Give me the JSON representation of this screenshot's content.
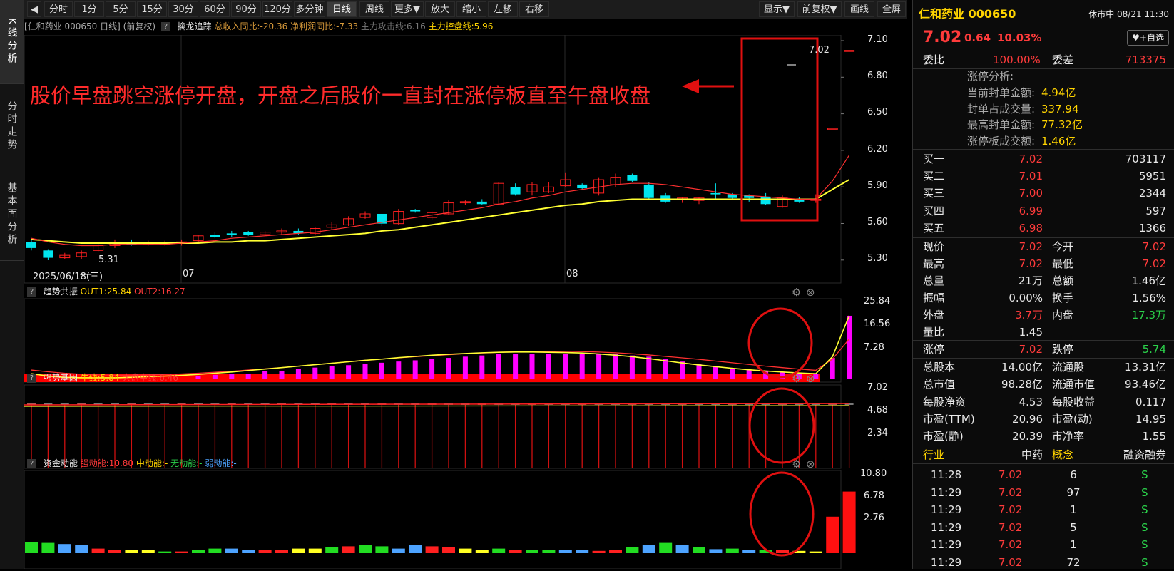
{
  "left_tabs": [
    "K线分析",
    "分时走势",
    "基本面分析"
  ],
  "toolbar": {
    "back_label": "◀",
    "periods": [
      "分时",
      "1分",
      "5分",
      "15分",
      "30分",
      "60分",
      "90分",
      "120分",
      "多分钟",
      "日线",
      "周线",
      "更多▼"
    ],
    "active_period": "日线",
    "actions": [
      "放大",
      "缩小",
      "左移",
      "右移"
    ],
    "right": [
      "显示▼",
      "前复权▼",
      "画线",
      "全屏"
    ]
  },
  "main_info": {
    "name": "[仁和药业 000650 日线]",
    "adjust": "(前复权)",
    "indicator": "擒龙追踪",
    "revenue": "总收入同比:-20.36",
    "profit": "净利润同比:-7.33",
    "attack": "主力攻击线:6.16",
    "control": "主力控盘线:5.96"
  },
  "annotation": "股价早盘跳空涨停开盘，开盘之后股价一直封在涨停板直至午盘收盘",
  "price_axis": [
    "7.10",
    "6.80",
    "6.50",
    "6.20",
    "5.90",
    "5.60",
    "5.30"
  ],
  "last_price_tag": "7.02",
  "low_price_tag": "5.31",
  "date_axis": {
    "start": "2025/06/18(三)",
    "m1": "07",
    "m2": "08"
  },
  "sub1": {
    "title": "趋势共振",
    "out1": "OUT1:25.84",
    "out2": "OUT2:16.27",
    "axis": [
      "25.84",
      "16.56",
      "7.28"
    ]
  },
  "sub2": {
    "title": "强势基因",
    "bull": "牛线:5.84",
    "market": "大盘中线:6.46",
    "axis": [
      "7.02",
      "4.68",
      "2.34"
    ]
  },
  "sub3": {
    "title": "资金动能",
    "strong": "强动能:10.80",
    "mid": "中动能:-",
    "none": "无动能:-",
    "weak": "弱动能:-",
    "axis": [
      "10.80",
      "6.78",
      "2.76"
    ]
  },
  "colors": {
    "up": "#ff2020",
    "down": "#00e5ee",
    "ma_yellow": "#ffff33",
    "magenta": "#ff00ff",
    "frame": "#e01010"
  },
  "chart_data": {
    "type": "candlestick",
    "ylim": [
      5.2,
      7.15
    ],
    "ohlc": [
      [
        5.45,
        5.47,
        5.38,
        5.4
      ],
      [
        5.38,
        5.39,
        5.3,
        5.32
      ],
      [
        5.32,
        5.36,
        5.31,
        5.34
      ],
      [
        5.33,
        5.38,
        5.31,
        5.36
      ],
      [
        5.38,
        5.44,
        5.37,
        5.42
      ],
      [
        5.42,
        5.47,
        5.4,
        5.44
      ],
      [
        5.45,
        5.47,
        5.42,
        5.43
      ],
      [
        5.43,
        5.46,
        5.42,
        5.44
      ],
      [
        5.44,
        5.46,
        5.42,
        5.44
      ],
      [
        5.44,
        5.47,
        5.42,
        5.45
      ],
      [
        5.46,
        5.51,
        5.44,
        5.5
      ],
      [
        5.51,
        5.53,
        5.48,
        5.49
      ],
      [
        5.52,
        5.54,
        5.49,
        5.51
      ],
      [
        5.53,
        5.54,
        5.5,
        5.51
      ],
      [
        5.51,
        5.54,
        5.5,
        5.53
      ],
      [
        5.53,
        5.56,
        5.51,
        5.54
      ],
      [
        5.54,
        5.56,
        5.51,
        5.52
      ],
      [
        5.52,
        5.57,
        5.51,
        5.56
      ],
      [
        5.57,
        5.61,
        5.55,
        5.59
      ],
      [
        5.59,
        5.66,
        5.58,
        5.64
      ],
      [
        5.65,
        5.7,
        5.64,
        5.68
      ],
      [
        5.68,
        5.67,
        5.58,
        5.6
      ],
      [
        5.6,
        5.72,
        5.59,
        5.7
      ],
      [
        5.71,
        5.72,
        5.69,
        5.7
      ],
      [
        5.65,
        5.7,
        5.63,
        5.69
      ],
      [
        5.68,
        5.79,
        5.67,
        5.77
      ],
      [
        5.77,
        5.79,
        5.75,
        5.78
      ],
      [
        5.78,
        5.8,
        5.75,
        5.76
      ],
      [
        5.76,
        5.94,
        5.75,
        5.93
      ],
      [
        5.9,
        5.93,
        5.83,
        5.84
      ],
      [
        5.86,
        5.94,
        5.83,
        5.92
      ],
      [
        5.86,
        5.94,
        5.85,
        5.9
      ],
      [
        5.91,
        6.02,
        5.9,
        5.96
      ],
      [
        5.92,
        5.93,
        5.88,
        5.89
      ],
      [
        5.85,
        5.98,
        5.83,
        5.96
      ],
      [
        5.92,
        6.01,
        5.9,
        5.98
      ],
      [
        6.0,
        6.01,
        5.94,
        5.95
      ],
      [
        5.92,
        5.94,
        5.8,
        5.81
      ],
      [
        5.83,
        5.85,
        5.77,
        5.78
      ],
      [
        5.8,
        5.82,
        5.77,
        5.81
      ],
      [
        5.79,
        5.82,
        5.76,
        5.81
      ],
      [
        5.85,
        5.93,
        5.8,
        5.84
      ],
      [
        5.84,
        5.85,
        5.8,
        5.81
      ],
      [
        5.83,
        5.84,
        5.78,
        5.81
      ],
      [
        5.82,
        5.85,
        5.75,
        5.76
      ],
      [
        5.74,
        5.83,
        5.73,
        5.81
      ],
      [
        5.8,
        5.82,
        5.77,
        5.78
      ],
      [
        5.79,
        5.84,
        5.77,
        5.8
      ],
      [
        6.38,
        6.38,
        6.38,
        6.38
      ],
      [
        7.02,
        7.02,
        7.02,
        7.02
      ]
    ],
    "attack_line": [
      5.48,
      5.45,
      5.43,
      5.42,
      5.42,
      5.43,
      5.43,
      5.43,
      5.43,
      5.44,
      5.45,
      5.46,
      5.48,
      5.49,
      5.5,
      5.51,
      5.52,
      5.53,
      5.55,
      5.57,
      5.59,
      5.61,
      5.63,
      5.65,
      5.67,
      5.69,
      5.71,
      5.73,
      5.76,
      5.78,
      5.81,
      5.83,
      5.86,
      5.88,
      5.9,
      5.92,
      5.93,
      5.93,
      5.92,
      5.9,
      5.88,
      5.86,
      5.84,
      5.83,
      5.82,
      5.81,
      5.8,
      5.8,
      5.95,
      6.16
    ],
    "control_line": [
      5.47,
      5.46,
      5.45,
      5.44,
      5.44,
      5.44,
      5.44,
      5.44,
      5.44,
      5.44,
      5.44,
      5.45,
      5.45,
      5.46,
      5.46,
      5.47,
      5.48,
      5.49,
      5.5,
      5.51,
      5.52,
      5.54,
      5.55,
      5.57,
      5.59,
      5.61,
      5.63,
      5.65,
      5.67,
      5.69,
      5.71,
      5.73,
      5.75,
      5.76,
      5.78,
      5.79,
      5.8,
      5.8,
      5.8,
      5.8,
      5.8,
      5.8,
      5.8,
      5.8,
      5.8,
      5.8,
      5.8,
      5.8,
      5.88,
      5.96
    ],
    "sub1_bars": [
      1.5,
      0,
      0,
      0,
      0,
      0,
      0,
      0,
      0,
      0,
      1,
      1.5,
      2,
      2,
      3,
      3,
      4,
      4.5,
      5,
      5.5,
      6,
      6.5,
      7,
      7.5,
      8,
      8.5,
      9,
      9.5,
      10,
      10,
      10,
      10,
      10.2,
      10,
      10,
      10,
      9.5,
      9,
      8,
      7,
      6,
      5,
      4,
      3.5,
      3,
      2.5,
      2,
      2,
      8.5,
      25.84
    ],
    "sub1_lines": {
      "out1": [
        2,
        1,
        0.5,
        0.3,
        0.3,
        0.3,
        0.5,
        0.8,
        1,
        1.3,
        1.7,
        2.2,
        2.7,
        3.3,
        3.9,
        4.5,
        5.1,
        5.7,
        6.3,
        6.9,
        7.5,
        8,
        8.6,
        9.1,
        9.6,
        10,
        10.3,
        10.6,
        10.8,
        10.9,
        10.9,
        10.8,
        10.7,
        10.5,
        10.1,
        9.6,
        9,
        8.2,
        7.3,
        6.4,
        5.6,
        4.9,
        4.2,
        3.6,
        3.1,
        2.7,
        2.3,
        2,
        9,
        25.84
      ],
      "out2": [
        3.5,
        2.8,
        2.2,
        1.8,
        1.5,
        1.4,
        1.4,
        1.5,
        1.7,
        1.9,
        2.2,
        2.6,
        3,
        3.5,
        4,
        4.5,
        5.1,
        5.7,
        6.3,
        6.9,
        7.5,
        8,
        8.5,
        9,
        9.4,
        9.8,
        10.2,
        10.5,
        10.8,
        11,
        11.1,
        11.2,
        11.2,
        11.1,
        10.9,
        10.6,
        10.2,
        9.7,
        9.1,
        8.5,
        7.9,
        7.2,
        6.5,
        5.8,
        5.1,
        4.5,
        3.9,
        3.4,
        8,
        16.27
      ]
    },
    "sub2": {
      "bull": 5.84,
      "market": 6.46
    },
    "sub3_bars": [
      2,
      1.8,
      1.6,
      1.4,
      0.8,
      0.6,
      0.6,
      0.5,
      0.3,
      0.3,
      0.6,
      0.8,
      0.8,
      0.6,
      0.5,
      0.6,
      0.8,
      0.8,
      1,
      1.2,
      1.4,
      1.2,
      0.8,
      1.5,
      1.2,
      1,
      0.8,
      0.6,
      0.8,
      0.6,
      0.6,
      0.5,
      0.6,
      0.5,
      0.4,
      0.5,
      1,
      1.5,
      1.8,
      1.5,
      1,
      0.7,
      0.8,
      0.6,
      0.6,
      0.5,
      0.4,
      0.3,
      6.4,
      10.8
    ]
  },
  "quote": {
    "title": "仁和药业 000650",
    "status": "休市中 08/21 11:30",
    "price": "7.02",
    "change": "0.64",
    "pct": "10.03%",
    "fav": "♥+自选",
    "weibi_label": "委比",
    "weibi": "100.00%",
    "weicha_label": "委差",
    "weicha": "713375",
    "limit": {
      "title": "涨停分析:",
      "rows": [
        {
          "label": "当前封单金额:",
          "value": "4.94亿"
        },
        {
          "label": "封单占成交量:",
          "value": "337.94"
        },
        {
          "label": "最高封单金额:",
          "value": "77.32亿"
        },
        {
          "label": "涨停板成交额:",
          "value": "1.46亿"
        }
      ]
    },
    "bids": [
      {
        "label": "买一",
        "price": "7.02",
        "vol": "703117"
      },
      {
        "label": "买二",
        "price": "7.01",
        "vol": "5951"
      },
      {
        "label": "买三",
        "price": "7.00",
        "vol": "2344"
      },
      {
        "label": "买四",
        "price": "6.99",
        "vol": "597"
      },
      {
        "label": "买五",
        "price": "6.98",
        "vol": "1366"
      }
    ],
    "stats1": [
      {
        "l1": "现价",
        "v1": "7.02",
        "c1": "red",
        "l2": "今开",
        "v2": "7.02",
        "c2": "red"
      },
      {
        "l1": "最高",
        "v1": "7.02",
        "c1": "red",
        "l2": "最低",
        "v2": "7.02",
        "c2": "red"
      },
      {
        "l1": "总量",
        "v1": "21万",
        "c1": "white",
        "l2": "总额",
        "v2": "1.46亿",
        "c2": "white"
      }
    ],
    "stats2": [
      {
        "l1": "振幅",
        "v1": "0.00%",
        "c1": "white",
        "l2": "换手",
        "v2": "1.56%",
        "c2": "white"
      },
      {
        "l1": "外盘",
        "v1": "3.7万",
        "c1": "red",
        "l2": "内盘",
        "v2": "17.3万",
        "c2": "green"
      },
      {
        "l1": "量比",
        "v1": "1.45",
        "c1": "white",
        "l2": "",
        "v2": "",
        "c2": "white"
      }
    ],
    "limits": {
      "up_label": "涨停",
      "up": "7.02",
      "down_label": "跌停",
      "down": "5.74"
    },
    "fund": [
      {
        "l1": "总股本",
        "v1": "14.00亿",
        "l2": "流通股",
        "v2": "13.31亿"
      },
      {
        "l1": "总市值",
        "v1": "98.28亿",
        "l2": "流通市值",
        "v2": "93.46亿"
      },
      {
        "l1": "每股净资",
        "v1": "4.53",
        "l2": "每股收益",
        "v2": "0.117"
      },
      {
        "l1": "市盈(TTM)",
        "v1": "20.96",
        "l2": "市盈(动)",
        "v2": "14.95"
      },
      {
        "l1": "市盈(静)",
        "v1": "20.39",
        "l2": "市净率",
        "v2": "1.55"
      }
    ],
    "industry": {
      "l1": "行业",
      "v1": "中药",
      "l2": "概念",
      "v2": "融资融券"
    },
    "ticks": [
      {
        "time": "11:28",
        "price": "7.02",
        "vol": "6",
        "side": "S"
      },
      {
        "time": "11:29",
        "price": "7.02",
        "vol": "97",
        "side": "S"
      },
      {
        "time": "11:29",
        "price": "7.02",
        "vol": "1",
        "side": "S"
      },
      {
        "time": "11:29",
        "price": "7.02",
        "vol": "5",
        "side": "S"
      },
      {
        "time": "11:29",
        "price": "7.02",
        "vol": "1",
        "side": "S"
      },
      {
        "time": "11:29",
        "price": "7.02",
        "vol": "72",
        "side": "S"
      }
    ]
  }
}
